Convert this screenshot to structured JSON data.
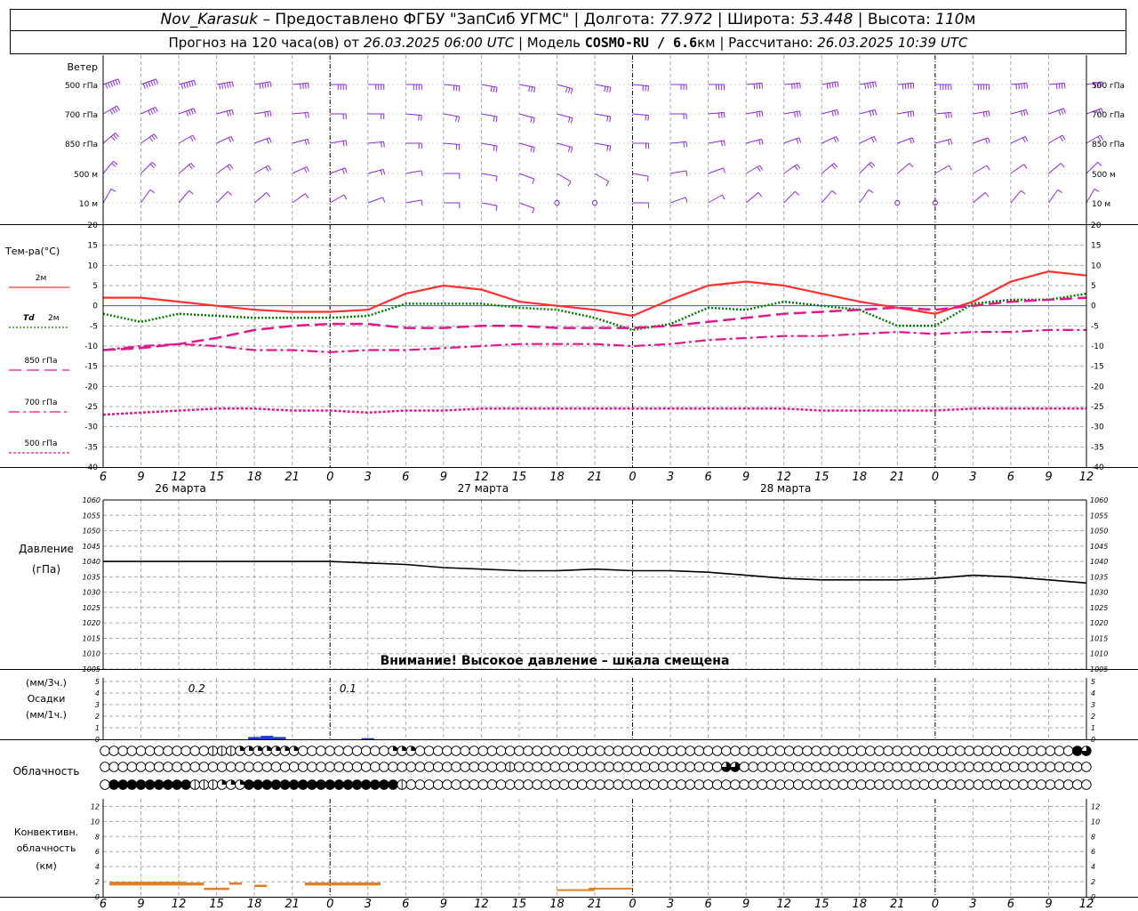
{
  "header": {
    "station": "Nov_Karasuk",
    "provider": " – Предоставлено ФГБУ \"ЗапСиб УГМС\" | Долгота: ",
    "lon": "77.972",
    "lat_label": " | Широта: ",
    "lat": "53.448",
    "alt_label": " | Высота: ",
    "alt": "110",
    "alt_unit": "м",
    "forecast_label": "Прогноз на 120 часа(ов) от ",
    "forecast_from": "26.03.2025 06:00 UTC",
    "model_label": " | Модель ",
    "model": "COSMO-RU / 6.6",
    "model_unit": "км",
    "calc_label": " | Рассчитано: ",
    "calc_time": "26.03.2025 10:39 UTC"
  },
  "labels": {
    "wind": "Ветер",
    "wind_levels": [
      "500 гПа",
      "700 гПа",
      "850 гПа",
      "500 м",
      "10 м"
    ],
    "temp_title": "Тем-ра(°C)",
    "temp_2m": "2м",
    "td": "Td",
    "td_2m": "2м",
    "t850": "850 гПа",
    "t700": "700 гПа",
    "t500": "500 гПа",
    "pressure_1": "Давление",
    "pressure_2": "(гПа)",
    "pressure_warning": "Внимание! Высокое давление – шкала смещена",
    "precip_1": "(мм/3ч.)",
    "precip_2": "Осадки",
    "precip_3": "(мм/1ч.)",
    "cloud": "Облачность",
    "conv_1": "Конвективн.",
    "conv_2": "облачность",
    "conv_3": "(км)",
    "precip_annotations": [
      "0.2",
      "0.1"
    ]
  },
  "colors": {
    "t2m": "#ff3030",
    "td2m": "#008000",
    "t850": "#e0188a",
    "t700": "#e0188a",
    "t500": "#e0188a",
    "wind": "#8a2be2",
    "precip": "#1f3fd0",
    "convective": "#e08020",
    "pressure": "#000000",
    "grid": "#a8a8a8"
  },
  "chart_data": {
    "type": "line",
    "time_ticks": [
      "6",
      "9",
      "12",
      "15",
      "18",
      "21",
      "0",
      "3",
      "6",
      "9",
      "12",
      "15",
      "18",
      "21",
      "0",
      "3",
      "6",
      "9",
      "12",
      "15",
      "18",
      "21",
      "0",
      "3",
      "6",
      "9",
      "12"
    ],
    "day_labels": [
      "26 марта",
      "27 марта",
      "28 марта"
    ],
    "hours": [
      0,
      3,
      6,
      9,
      12,
      15,
      18,
      21,
      24,
      27,
      30,
      33,
      36,
      39,
      42,
      45,
      48,
      51,
      54,
      57,
      60,
      63,
      66,
      69,
      72,
      75,
      78
    ],
    "temperature": {
      "ylim": [
        -40,
        20
      ],
      "ticks": [
        20,
        15,
        10,
        5,
        0,
        -5,
        -10,
        -15,
        -20,
        -25,
        -30,
        -35,
        -40
      ],
      "series": [
        {
          "name": "2м",
          "values": [
            2,
            2,
            1,
            0,
            -1,
            -1.5,
            -1.5,
            -1,
            3,
            5,
            4,
            1,
            0,
            -1,
            -2.5,
            1.5,
            5,
            6,
            5,
            3,
            1,
            -0.5,
            -2,
            1,
            6,
            8.5,
            7.5
          ]
        },
        {
          "name": "Td 2м",
          "values": [
            -2,
            -4,
            -2,
            -2.5,
            -3,
            -3,
            -3,
            -2.5,
            0.5,
            0.5,
            0.5,
            -0.5,
            -1,
            -3,
            -6,
            -4.5,
            -0.5,
            -1,
            1,
            0,
            -1,
            -5,
            -5,
            0.5,
            1.5,
            1.5,
            3
          ]
        },
        {
          "name": "850 гПа",
          "values": [
            -11,
            -10.5,
            -9.5,
            -8,
            -6,
            -5,
            -4.5,
            -4.5,
            -5.5,
            -5.5,
            -5,
            -5,
            -5.5,
            -5.5,
            -5.5,
            -5,
            -4,
            -3,
            -2,
            -1.5,
            -1,
            -0.5,
            -1,
            0,
            1,
            1.5,
            2
          ]
        },
        {
          "name": "700 гПа",
          "values": [
            -11,
            -10,
            -9.5,
            -10,
            -11,
            -11,
            -11.5,
            -11,
            -11,
            -10.5,
            -10,
            -9.5,
            -9.5,
            -9.5,
            -10,
            -9.5,
            -8.5,
            -8,
            -7.5,
            -7.5,
            -7,
            -6.5,
            -7,
            -6.5,
            -6.5,
            -6,
            -6
          ]
        },
        {
          "name": "500 гПа",
          "values": [
            -27,
            -26.5,
            -26,
            -25.5,
            -25.5,
            -26,
            -26,
            -26.5,
            -26,
            -26,
            -25.5,
            -25.5,
            -25.5,
            -25.5,
            -25.5,
            -25.5,
            -25.5,
            -25.5,
            -25.5,
            -26,
            -26,
            -26,
            -26,
            -25.5,
            -25.5,
            -25.5,
            -25.5
          ]
        }
      ]
    },
    "pressure": {
      "ylim": [
        1005,
        1060
      ],
      "ticks": [
        1060,
        1055,
        1050,
        1045,
        1040,
        1035,
        1030,
        1025,
        1020,
        1015,
        1010,
        1005
      ],
      "values": [
        1040,
        1040,
        1040,
        1040,
        1040,
        1040,
        1040,
        1039.5,
        1039,
        1038,
        1037.5,
        1037,
        1037,
        1037.5,
        1037,
        1037,
        1036.5,
        1035.5,
        1034.5,
        1034,
        1034,
        1034,
        1034.5,
        1035.5,
        1035,
        1034,
        1033
      ]
    },
    "precipitation": {
      "ylim": [
        0,
        5
      ],
      "ticks": [
        5,
        4,
        3,
        2,
        1,
        0
      ],
      "bars": [
        {
          "h": 12,
          "v": 0.2
        },
        {
          "h": 13,
          "v": 0.3
        },
        {
          "h": 14,
          "v": 0.2
        },
        {
          "h": 21,
          "v": 0.1
        }
      ],
      "annotations": [
        {
          "h": 13,
          "text": "0.2"
        },
        {
          "h": 25,
          "text": "0.1"
        }
      ]
    },
    "cloud_cover": {
      "rows": [
        "0000000000001112222222000000000022200000000000000000000000000000000000000000000000000000000000000000000000004344444",
        "0000000000000000000000000000000000000000000001000000000000000000000003300000000000000000000000000000000000000000",
        "0444444444111222444444444444444441000000000000000000000000000000000000000000000000000000000000000000000000000021111"
      ]
    },
    "convective_clouds": {
      "ylim": [
        0,
        13
      ],
      "ticks": [
        12,
        10,
        8,
        6,
        4,
        2,
        0
      ],
      "segments": [
        {
          "from": 0.5,
          "to": 6.5,
          "base": 1.5,
          "top": 2
        },
        {
          "from": 6,
          "to": 8,
          "base": 1.5,
          "top": 1.9
        },
        {
          "from": 8,
          "to": 10,
          "base": 0.9,
          "top": 1.2
        },
        {
          "from": 10,
          "to": 11,
          "base": 1.6,
          "top": 1.9
        },
        {
          "from": 12,
          "to": 13,
          "base": 1.3,
          "top": 1.6
        },
        {
          "from": 16,
          "to": 22,
          "base": 1.5,
          "top": 1.9
        },
        {
          "from": 36,
          "to": 39,
          "base": 0.8,
          "top": 1
        },
        {
          "from": 38.5,
          "to": 42,
          "base": 1,
          "top": 1.2
        }
      ]
    },
    "wind": {
      "levels": [
        "500 гПа",
        "700 гПа",
        "850 гПа",
        "500 м",
        "10 м"
      ],
      "direction_deg": [
        [
          250,
          250,
          255,
          260,
          260,
          265,
          270,
          270,
          270,
          275,
          280,
          280,
          285,
          280,
          275,
          270,
          270,
          265,
          265,
          260,
          260,
          265,
          270,
          270,
          265,
          265,
          260
        ],
        [
          240,
          245,
          250,
          255,
          260,
          265,
          270,
          270,
          275,
          280,
          280,
          285,
          285,
          280,
          275,
          270,
          265,
          260,
          260,
          255,
          255,
          260,
          265,
          260,
          255,
          250,
          250
        ],
        [
          230,
          235,
          240,
          245,
          250,
          255,
          260,
          265,
          270,
          275,
          280,
          285,
          285,
          280,
          270,
          265,
          260,
          255,
          250,
          245,
          245,
          250,
          255,
          250,
          245,
          240,
          240
        ],
        [
          220,
          225,
          230,
          235,
          240,
          245,
          250,
          255,
          260,
          270,
          280,
          290,
          300,
          300,
          280,
          260,
          250,
          240,
          235,
          230,
          225,
          230,
          240,
          240,
          235,
          230,
          225
        ],
        [
          210,
          215,
          220,
          225,
          230,
          235,
          240,
          250,
          260,
          270,
          280,
          290,
          0,
          0,
          270,
          250,
          240,
          230,
          225,
          220,
          215,
          0,
          0,
          230,
          220,
          215,
          210
        ]
      ],
      "speed_ms": [
        [
          35,
          33,
          30,
          28,
          25,
          22,
          20,
          18,
          18,
          17,
          17,
          16,
          15,
          15,
          16,
          17,
          18,
          20,
          22,
          23,
          24,
          24,
          25,
          24,
          23,
          22,
          22
        ],
        [
          22,
          20,
          18,
          16,
          14,
          12,
          12,
          12,
          12,
          11,
          10,
          10,
          10,
          10,
          11,
          12,
          13,
          14,
          15,
          16,
          16,
          15,
          15,
          14,
          14,
          13,
          13
        ],
        [
          14,
          13,
          12,
          11,
          10,
          10,
          10,
          9,
          9,
          8,
          8,
          8,
          8,
          8,
          9,
          10,
          11,
          12,
          12,
          12,
          12,
          11,
          11,
          10,
          10,
          9,
          9
        ],
        [
          10,
          10,
          9,
          9,
          8,
          8,
          8,
          8,
          7,
          6,
          5,
          5,
          4,
          4,
          5,
          6,
          7,
          8,
          8,
          8,
          8,
          7,
          6,
          6,
          6,
          5,
          5
        ],
        [
          6,
          6,
          6,
          5,
          5,
          5,
          5,
          4,
          4,
          3,
          3,
          2,
          0,
          0,
          3,
          4,
          4,
          5,
          5,
          4,
          4,
          0,
          0,
          3,
          3,
          3,
          3
        ]
      ]
    }
  }
}
